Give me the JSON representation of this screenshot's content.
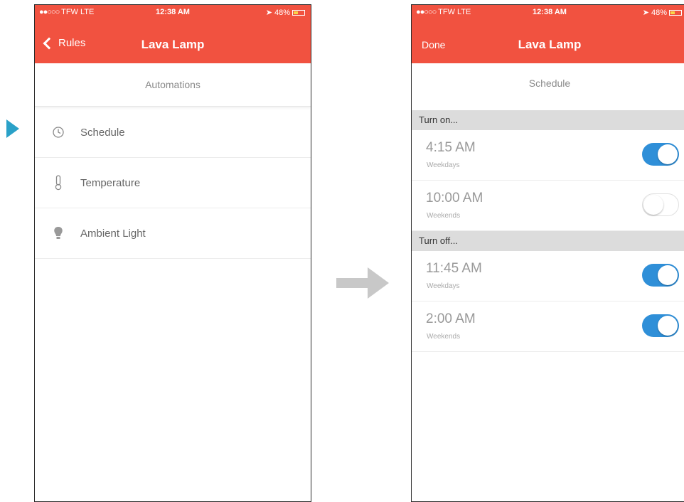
{
  "colors": {
    "navbar": "#f15240",
    "toggle_on": "#2f8fd8",
    "pointer": "#2aa1c8",
    "flow_arrow": "#c8c8c8"
  },
  "status_bar": {
    "left_screen": {
      "carrier": "TFW  LTE",
      "time": "12:38 AM",
      "battery": "48%"
    },
    "right_screen": {
      "carrier": "TFW  LTE",
      "time": "12:38 AM",
      "battery": "48%"
    }
  },
  "automations_screen": {
    "back_label": "Rules",
    "title": "Lava Lamp",
    "subheader": "Automations",
    "items": [
      {
        "label": "Schedule",
        "icon": "clock-icon"
      },
      {
        "label": "Temperature",
        "icon": "thermometer-icon"
      },
      {
        "label": "Ambient Light",
        "icon": "lightbulb-icon"
      }
    ]
  },
  "schedule_screen": {
    "done_label": "Done",
    "title": "Lava Lamp",
    "subheader": "Schedule",
    "sections": [
      {
        "header": "Turn on...",
        "rows": [
          {
            "time": "4:15 AM",
            "days": "Weekdays",
            "enabled": true
          },
          {
            "time": "10:00 AM",
            "days": "Weekends",
            "enabled": false
          }
        ]
      },
      {
        "header": "Turn off...",
        "rows": [
          {
            "time": "11:45 AM",
            "days": "Weekdays",
            "enabled": true
          },
          {
            "time": "2:00 AM",
            "days": "Weekends",
            "enabled": true
          }
        ]
      }
    ]
  }
}
